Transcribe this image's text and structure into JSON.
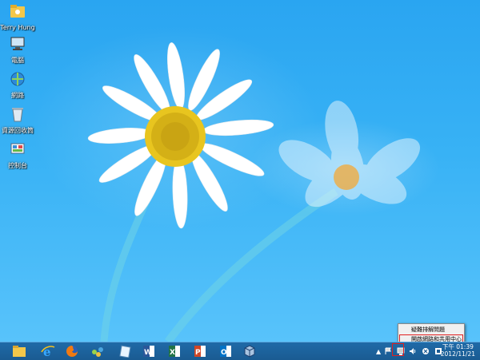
{
  "desktop": {
    "icons": [
      {
        "label": "Terry Hung",
        "icon": "user-folder-icon"
      },
      {
        "label": "電腦",
        "icon": "computer-icon"
      },
      {
        "label": "網路",
        "icon": "network-icon"
      },
      {
        "label": "資源回收筒",
        "icon": "recycle-bin-icon"
      },
      {
        "label": "控制台",
        "icon": "control-panel-icon"
      }
    ]
  },
  "taskbar": {
    "apps": [
      "file-explorer-icon",
      "internet-explorer-icon",
      "firefox-icon",
      "network-app-icon",
      "notepad-icon",
      "word-icon",
      "excel-icon",
      "powerpoint-icon",
      "outlook-icon",
      "virtualbox-icon"
    ]
  },
  "tray": {
    "icons": [
      "show-hidden-icons-icon",
      "flag-icon",
      "network-icon",
      "volume-icon",
      "security-icon",
      "keyboard-icon"
    ],
    "time": "下午 01:39",
    "date": "2012/11/21"
  },
  "context_menu": {
    "items": [
      "疑難排解問題",
      "開啟網路和共用中心"
    ]
  },
  "colors": {
    "taskbar": "#1a5b92",
    "highlight": "#e02020"
  }
}
